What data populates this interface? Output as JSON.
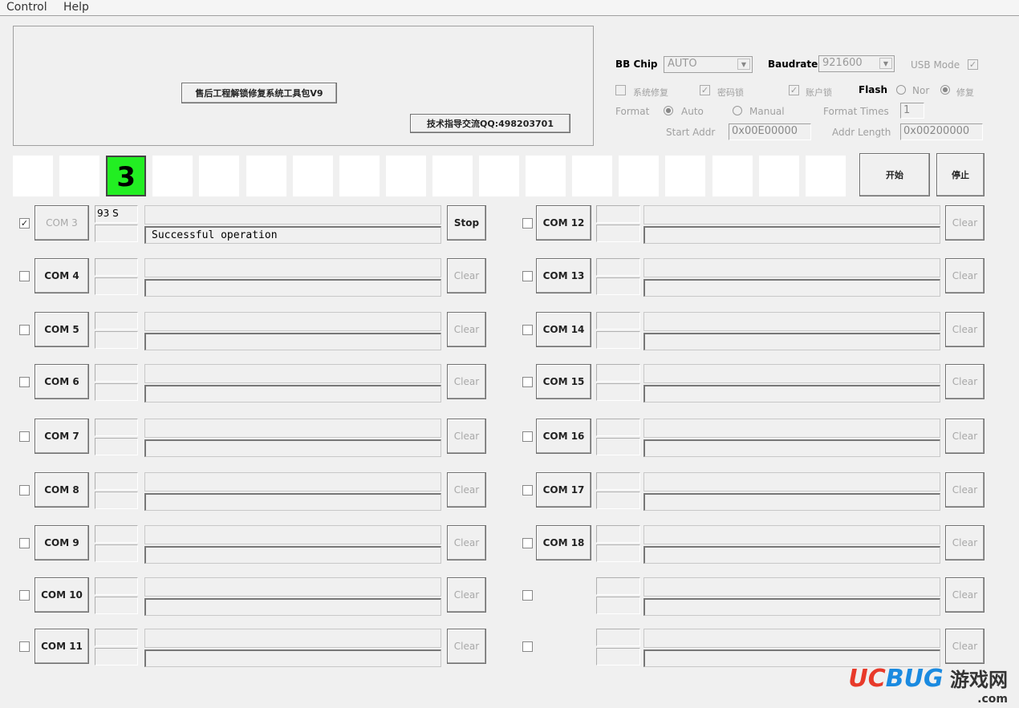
{
  "menu": [
    "Control",
    "Help"
  ],
  "header": {
    "title_button": "售后工程解锁修复系统工具包V9",
    "qq_button": "技术指导交流QQ:498203701"
  },
  "settings": {
    "bb_chip_label": "BB Chip",
    "bb_chip_value": "AUTO",
    "baudrate_label": "Baudrate",
    "baudrate_value": "921600",
    "usb_mode_label": "USB Mode",
    "usb_mode_checked": true,
    "sys_repair_label": "系统修复",
    "sys_repair_checked": false,
    "pwd_lock_label": "密码锁",
    "pwd_lock_checked": true,
    "account_lock_label": "账户锁",
    "account_lock_checked": true,
    "flash_label": "Flash",
    "flash_nor_label": "Nor",
    "flash_repair_label": "修复",
    "flash_selected": "修复",
    "format_label": "Format",
    "format_auto_label": "Auto",
    "format_manual_label": "Manual",
    "format_selected": "Auto",
    "format_times_label": "Format Times",
    "format_times_value": "1",
    "start_addr_label": "Start Addr",
    "start_addr_value": "0x00E00000",
    "addr_length_label": "Addr Length",
    "addr_length_value": "0x00200000"
  },
  "slots": [
    "",
    "",
    "3",
    "",
    "",
    "",
    "",
    "",
    "",
    "",
    "",
    "",
    "",
    "",
    "",
    "",
    "",
    ""
  ],
  "active_slot_color": "#22ee22",
  "start_button": "开始",
  "stop_button": "停止",
  "ports_left": [
    {
      "checked": true,
      "name": "COM 3",
      "name_enabled": false,
      "time": "93 S",
      "status": "Successful operation",
      "action": "Stop",
      "action_enabled": true
    },
    {
      "checked": false,
      "name": "COM 4",
      "action": "Clear"
    },
    {
      "checked": false,
      "name": "COM 5",
      "action": "Clear"
    },
    {
      "checked": false,
      "name": "COM 6",
      "action": "Clear"
    },
    {
      "checked": false,
      "name": "COM 7",
      "action": "Clear"
    },
    {
      "checked": false,
      "name": "COM 8",
      "action": "Clear"
    },
    {
      "checked": false,
      "name": "COM 9",
      "action": "Clear"
    },
    {
      "checked": false,
      "name": "COM 10",
      "action": "Clear"
    },
    {
      "checked": false,
      "name": "COM 11",
      "action": "Clear"
    }
  ],
  "ports_right": [
    {
      "checked": false,
      "name": "COM 12",
      "action": "Clear"
    },
    {
      "checked": false,
      "name": "COM 13",
      "action": "Clear"
    },
    {
      "checked": false,
      "name": "COM 14",
      "action": "Clear"
    },
    {
      "checked": false,
      "name": "COM 15",
      "action": "Clear"
    },
    {
      "checked": false,
      "name": "COM 16",
      "action": "Clear"
    },
    {
      "checked": false,
      "name": "COM 17",
      "action": "Clear"
    },
    {
      "checked": false,
      "name": "COM 18",
      "action": "Clear"
    },
    {
      "checked": false,
      "name": "",
      "action": "Clear"
    },
    {
      "checked": false,
      "name": "",
      "action": "Clear"
    }
  ],
  "watermark": {
    "brand": "UCBUG",
    "cn": "游戏网",
    "domain": ".com"
  }
}
